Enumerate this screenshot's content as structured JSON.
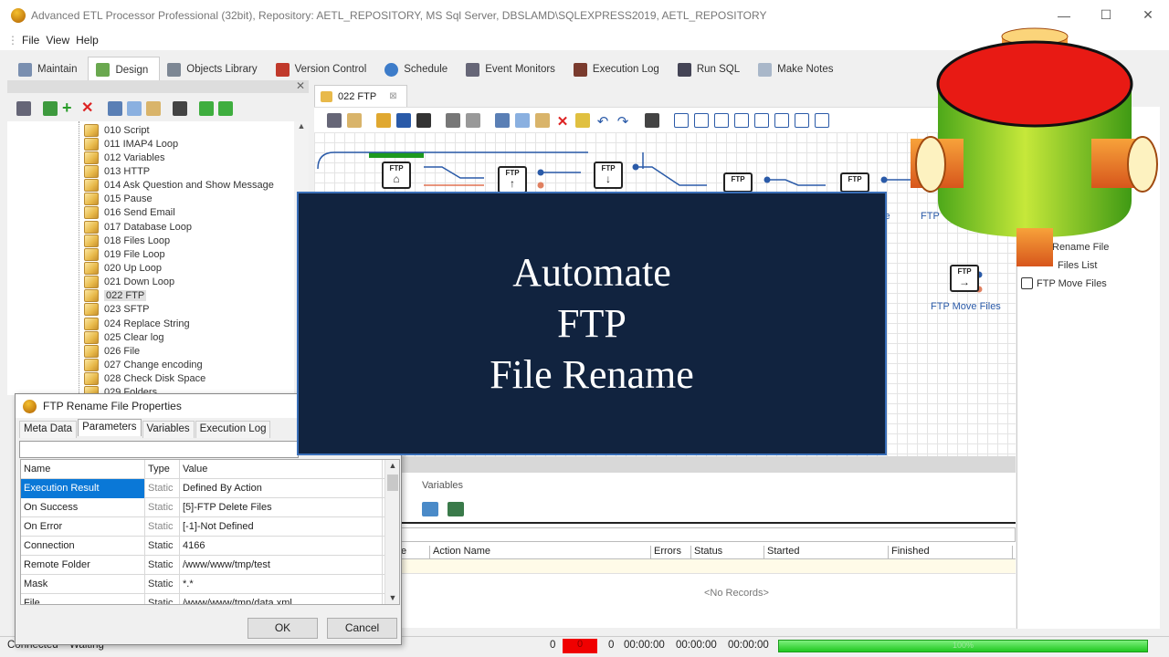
{
  "window": {
    "title": "Advanced ETL Processor Professional (32bit), Repository: AETL_REPOSITORY, MS Sql Server, DBSLAMD\\SQLEXPRESS2019, AETL_REPOSITORY",
    "minimize": "—",
    "maximize": "☐",
    "close": "✕"
  },
  "menu": [
    "File",
    "View",
    "Help"
  ],
  "main_tabs": [
    "Maintain",
    "Design",
    "Objects Library",
    "Version Control",
    "Schedule",
    "Event Monitors",
    "Execution Log",
    "Run SQL",
    "Make Notes"
  ],
  "left_panel": {
    "close": "✕",
    "tree": [
      "010 Script",
      "011 IMAP4 Loop",
      "012 Variables",
      "013 HTTP",
      "014 Ask Question and Show Message",
      "015 Pause",
      "016 Send Email",
      "017 Database Loop",
      "018 Files Loop",
      "019 File Loop",
      "020 Up Loop",
      "021 Down Loop",
      "022 FTP",
      "023 SFTP",
      "024 Replace String",
      "025 Clear log",
      "026 File",
      "027 Change encoding",
      "028 Check Disk Space",
      "029 Folders"
    ],
    "selected": "022 FTP"
  },
  "document": {
    "tab_label": "022 FTP",
    "tab_close": "⊠",
    "canvas_labels": [
      "le",
      "FTP Move Files",
      "FTP"
    ],
    "node_text": "FTP"
  },
  "right_panel": {
    "items": [
      "Rename File",
      "Files List",
      "FTP Move Files"
    ]
  },
  "bottom": {
    "tab": "Variables",
    "columns": [
      "e",
      "Action Name",
      "Errors",
      "Status",
      "Started",
      "Finished",
      ""
    ],
    "no_records": "<No Records>"
  },
  "status": {
    "left1": "Connected",
    "left2": "Waiting",
    "count1": "0",
    "red_value": "0",
    "count2": "0",
    "time1": "00:00:00",
    "time2": "00:00:00",
    "time3": "00:00:00",
    "progress_label": "100%"
  },
  "dialog": {
    "title": "FTP Rename File Properties",
    "close": "—",
    "tabs": [
      "Meta Data",
      "Parameters",
      "Variables",
      "Execution Log"
    ],
    "active_tab": "Parameters",
    "columns": [
      "Name",
      "Type",
      "Value"
    ],
    "rows": [
      {
        "name": "Execution Result",
        "type": "Static",
        "value": "Defined By Action"
      },
      {
        "name": "On Success",
        "type": "Static",
        "value": "[5]-FTP Delete Files"
      },
      {
        "name": "On Error",
        "type": "Static",
        "value": "[-1]-Not Defined"
      },
      {
        "name": "Connection",
        "type": "Static",
        "value": "4166"
      },
      {
        "name": "Remote Folder",
        "type": "Static",
        "value": "/www/www/tmp/test"
      },
      {
        "name": "Mask",
        "type": "Static",
        "value": "*.*"
      },
      {
        "name": "File",
        "type": "Static",
        "value": "/www/www/tmp/data.xml"
      }
    ],
    "ok": "OK",
    "cancel": "Cancel"
  },
  "overlay": {
    "lines": [
      "Automate",
      "FTP",
      "File Rename"
    ]
  },
  "colors": {
    "overlay_bg": "#11233f",
    "selection": "#0a78d7",
    "progress": "#1fc81f",
    "error_box": "#f00000"
  }
}
